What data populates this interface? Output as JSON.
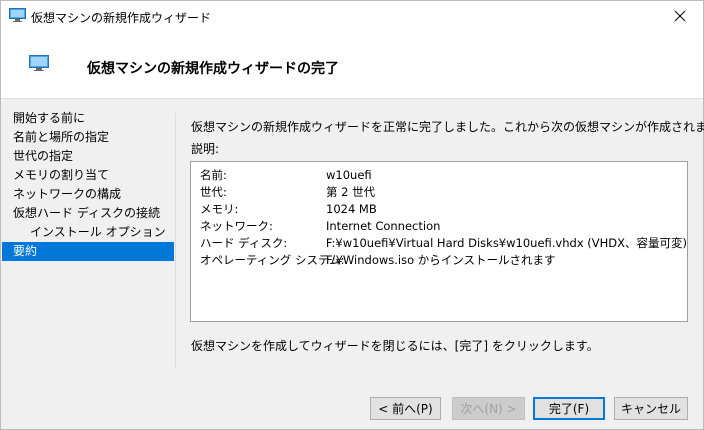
{
  "window": {
    "title": "仮想マシンの新規作成ウィザード"
  },
  "header": {
    "title": "仮想マシンの新規作成ウィザードの完了"
  },
  "nav": {
    "items": [
      {
        "label": "開始する前に"
      },
      {
        "label": "名前と場所の指定"
      },
      {
        "label": "世代の指定"
      },
      {
        "label": "メモリの割り当て"
      },
      {
        "label": "ネットワークの構成"
      },
      {
        "label": "仮想ハード ディスクの接続"
      },
      {
        "label": "インストール オプション"
      },
      {
        "label": "要約"
      }
    ],
    "selected_index": 7
  },
  "main": {
    "intro": "仮想マシンの新規作成ウィザードを正常に完了しました。これから次の仮想マシンが作成されます。",
    "description_label": "説明:",
    "summary": [
      {
        "key": "名前:",
        "value": "w10uefi"
      },
      {
        "key": "世代:",
        "value": "第 2 世代"
      },
      {
        "key": "メモリ:",
        "value": "1024 MB"
      },
      {
        "key": "ネットワーク:",
        "value": "Internet Connection"
      },
      {
        "key": "ハード ディスク:",
        "value": "F:¥w10uefi¥Virtual Hard Disks¥w10uefi.vhdx (VHDX、容量可変)"
      },
      {
        "key": "オペレーティング システム:",
        "value": "F:¥Windows.iso からインストールされます"
      }
    ],
    "finish_note": "仮想マシンを作成してウィザードを閉じるには、[完了] をクリックします。"
  },
  "buttons": {
    "prev": "< 前へ(P)",
    "next": "次へ(N) >",
    "finish": "完了(F)",
    "cancel": "キャンセル"
  },
  "colors": {
    "accent": "#0078d7",
    "background": "#f0f0f0",
    "panel": "#ffffff"
  },
  "icons": {
    "app": "hyperv-vm-icon",
    "close": "close-icon"
  }
}
